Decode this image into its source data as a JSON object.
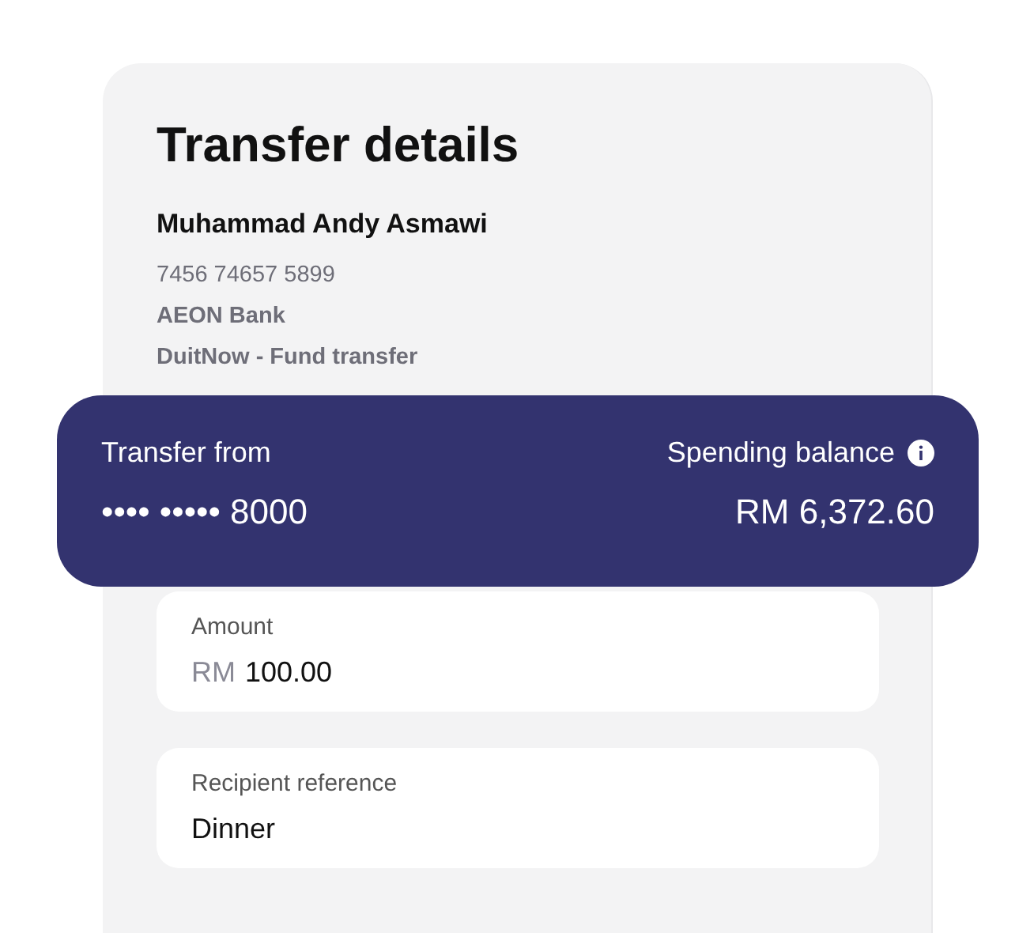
{
  "title": "Transfer details",
  "recipient": {
    "name": "Muhammad Andy Asmawi",
    "account_number": "7456 74657 5899",
    "bank": "AEON Bank",
    "method": "DuitNow - Fund transfer"
  },
  "source": {
    "label": "Transfer from",
    "account": "•••• ••••• 8000",
    "balance_label": "Spending balance",
    "balance": "RM 6,372.60"
  },
  "fields": [
    {
      "label": "Amount",
      "prefix": "RM",
      "value": "100.00"
    },
    {
      "label": "Recipient reference",
      "value": "Dinner"
    }
  ]
}
